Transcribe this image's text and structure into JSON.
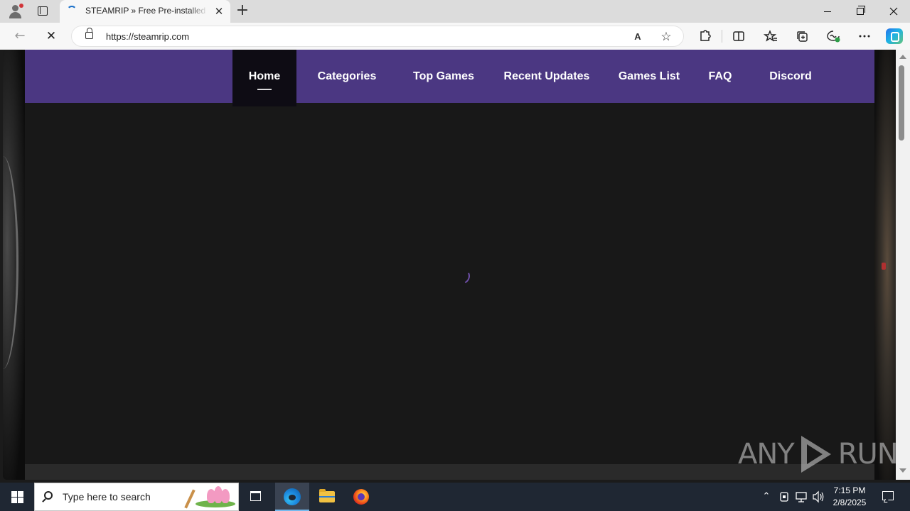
{
  "browser": {
    "tab": {
      "title": "STEAMRIP » Free Pre-installed Steam Games",
      "close_glyph": "✕"
    },
    "new_tab_glyph": "+",
    "window_controls": [
      "minimize",
      "restore",
      "close"
    ],
    "address_bar": {
      "url": "https://steamrip.com",
      "read_aloud_glyph": "A",
      "favorite_glyph": "☆"
    },
    "toolbar_icons": [
      "extensions-icon",
      "split-screen-icon",
      "favorites-icon",
      "collections-icon",
      "browser-essentials-icon",
      "more-icon",
      "copilot-icon"
    ],
    "nav": {
      "back_glyph": "←",
      "stop_glyph": "✕"
    }
  },
  "site": {
    "nav": [
      {
        "label": "Home",
        "active": true
      },
      {
        "label": "Categories",
        "active": false
      },
      {
        "label": "Top Games",
        "active": false
      },
      {
        "label": "Recent Updates",
        "active": false
      },
      {
        "label": "Games List",
        "active": false
      },
      {
        "label": "FAQ",
        "active": false
      },
      {
        "label": "Discord",
        "active": false
      }
    ],
    "accent_color": "#4b3782",
    "loading": true
  },
  "watermark": {
    "left_text": "ANY",
    "right_text": "RUN"
  },
  "taskbar": {
    "search_placeholder": "Type here to search",
    "apps": [
      "task-view-icon",
      "edge-icon",
      "file-explorer-icon",
      "firefox-icon"
    ],
    "tray": {
      "chevron_glyph": "⌃",
      "time": "7:15 PM",
      "date": "2/8/2025"
    }
  }
}
